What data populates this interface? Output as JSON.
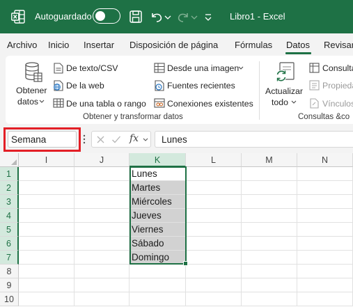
{
  "titlebar": {
    "autosave_label": "Autoguardado",
    "title": "Libro1  -  Excel"
  },
  "menu": {
    "tabs": [
      "Archivo",
      "Inicio",
      "Insertar",
      "Disposición de página",
      "Fórmulas",
      "Datos",
      "Revisar"
    ],
    "active_tab": "Datos"
  },
  "ribbon": {
    "get_data": {
      "line1": "Obtener",
      "line2": "datos"
    },
    "from_text_csv": "De texto/CSV",
    "from_web": "De la web",
    "from_table_range": "De una tabla o rango",
    "from_image": "Desde una imagen",
    "recent_sources": "Fuentes recientes",
    "existing_connections": "Conexiones existentes",
    "group_get_transform": "Obtener y transformar datos",
    "refresh_all": {
      "line1": "Actualizar",
      "line2": "todo"
    },
    "queries_connections": "Consulta",
    "properties": "Propieda",
    "links": "Vínculos",
    "group_queries": "Consultas &co"
  },
  "formula_bar": {
    "name_box": "Semana",
    "fx_symbol": "fx",
    "formula": "Lunes"
  },
  "grid": {
    "columns": [
      "I",
      "J",
      "K",
      "L",
      "M",
      "N"
    ],
    "selected_column": "K",
    "rows": [
      "1",
      "2",
      "3",
      "4",
      "5",
      "6",
      "7",
      "8",
      "9",
      "10"
    ],
    "selected_rows": [
      "1",
      "2",
      "3",
      "4",
      "5",
      "6",
      "7"
    ],
    "k_values": [
      "Lunes",
      "Martes",
      "Miércoles",
      "Jueves",
      "Viernes",
      "Sábado",
      "Domingo"
    ]
  },
  "colors": {
    "excel_green": "#1e7145",
    "highlight_red": "#e31f26",
    "selection_fill": "#d2d2d2"
  },
  "icons": [
    "excel-logo-icon",
    "toggle-switch",
    "save-icon",
    "undo-icon",
    "redo-icon",
    "customize-qat-icon"
  ]
}
